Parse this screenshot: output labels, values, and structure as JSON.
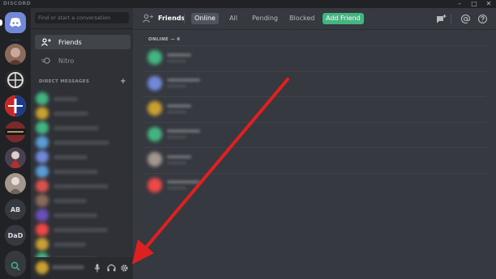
{
  "window": {
    "app_name": "DISCORD",
    "minimize": "–",
    "maximize": "□",
    "close": "✕"
  },
  "servers": [
    {
      "kind": "home",
      "icon": "discord-logo-icon",
      "color": "#7289da"
    },
    {
      "kind": "image",
      "color": "#8a6a5a"
    },
    {
      "kind": "image",
      "color": "#2b2b2b"
    },
    {
      "kind": "image",
      "color": "#c62828"
    },
    {
      "kind": "image",
      "color": "#7a2a2a"
    },
    {
      "kind": "image",
      "color": "#4a4050"
    },
    {
      "kind": "image",
      "color": "#a39890"
    },
    {
      "kind": "text",
      "label": "AB",
      "color": "#36393f"
    },
    {
      "kind": "text",
      "label": "DaD",
      "color": "#36393f"
    },
    {
      "kind": "add",
      "icon": "plus-icon",
      "color": "#36393f"
    },
    {
      "kind": "explore",
      "icon": "search-icon",
      "color": "#36393f"
    }
  ],
  "sidebar": {
    "search_placeholder": "Find or start a conversation",
    "friends_label": "Friends",
    "nitro_label": "Nitro",
    "dm_header": "DIRECT MESSAGES",
    "dm_add": "+",
    "dm_colors": [
      "#43b581",
      "#c9a032",
      "#43b581",
      "#5b9bd5",
      "#7289da",
      "#5b9bd5",
      "#d9534f",
      "#8a6a5a",
      "#6b4fbb",
      "#f04747",
      "#c9a032",
      "#43b581"
    ]
  },
  "user_panel": {
    "mic_icon": "microphone-icon",
    "headset_icon": "headphones-icon",
    "settings_icon": "gear-icon"
  },
  "topbar": {
    "friends_label": "Friends",
    "tabs": {
      "online": "Online",
      "all": "All",
      "pending": "Pending",
      "blocked": "Blocked",
      "add_friend": "Add Friend"
    }
  },
  "friends_list": {
    "header": "ONLINE — 6",
    "avatar_colors": [
      "#43b581",
      "#7289da",
      "#c9a032",
      "#43b581",
      "#a39890",
      "#f04747"
    ]
  },
  "annotation": {
    "arrow_color": "#e02020"
  }
}
